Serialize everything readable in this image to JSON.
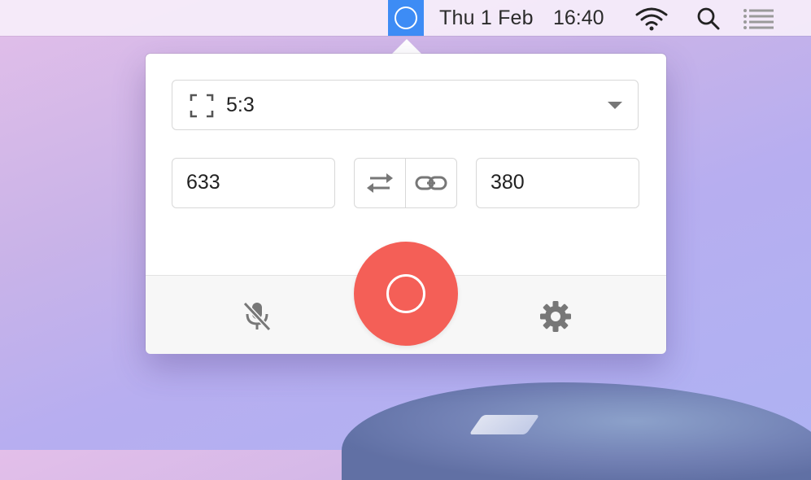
{
  "menubar": {
    "date": "Thu 1 Feb",
    "time": "16:40",
    "icons": [
      "app-status-icon",
      "wifi-icon",
      "spotlight-search-icon",
      "notification-center-icon"
    ]
  },
  "popover": {
    "aspect": {
      "icon": "frame-icon",
      "value": "5:3"
    },
    "width_value": "633",
    "height_value": "380",
    "controls": {
      "swap_icon": "swap-arrows-icon",
      "link_icon": "link-icon"
    },
    "footer": {
      "mic_icon": "mic-muted-icon",
      "record_icon": "record-icon",
      "settings_icon": "gear-icon"
    }
  },
  "colors": {
    "accent": "#3d8cf5",
    "record": "#f45f57"
  }
}
